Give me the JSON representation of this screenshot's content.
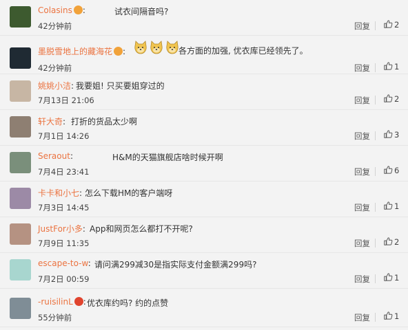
{
  "comments": [
    {
      "user": "Colasins",
      "text": "试衣间隔音吗?",
      "time": "42分钟前",
      "reply": "回复",
      "likes": "2",
      "badge": "#f1a23a",
      "avatar": "#3d5a2f"
    },
    {
      "user": "墨脱雪地上的藏海花",
      "text": "各方面的加强, 优衣库已经领先了。",
      "time": "42分钟前",
      "reply": "回复",
      "likes": "1",
      "badge": "#f1a23a",
      "avatar": "#1f2a33"
    },
    {
      "user": "姚姚小洁",
      "text": "我要姐! 只买要姐穿过的",
      "time": "7月13日 21:06",
      "reply": "回复",
      "likes": "2",
      "avatar": "#c7b6a4"
    },
    {
      "user": "轩大奇",
      "text": "打折的货品太少啊",
      "time": "7月1日 14:26",
      "reply": "回复",
      "likes": "3",
      "avatar": "#8e7f72"
    },
    {
      "user": "Seraout",
      "text": "H&M的天猫旗舰店啥时候开啊",
      "time": "7月4日 23:41",
      "reply": "回复",
      "likes": "6",
      "avatar": "#7a8f7b"
    },
    {
      "user": "卡卡和小七",
      "text": "怎么下载HM的客户端呀",
      "time": "7月3日 14:45",
      "reply": "回复",
      "likes": "1",
      "avatar": "#9c8aa6"
    },
    {
      "user": "JustFor小多",
      "text": "App和网页怎么都打不开呢?",
      "time": "7月9日 11:35",
      "reply": "回复",
      "likes": "2",
      "avatar": "#b59282"
    },
    {
      "user": "escape-to-w",
      "text": "请问满299减30是指实际支付金额满299吗?",
      "time": "7月2日 00:59",
      "reply": "回复",
      "likes": "1",
      "avatar": "#a8d6cf"
    },
    {
      "user": "-ruisilinL",
      "text": "优衣库约吗? 约的点赞",
      "time": "55分钟前",
      "reply": "回复",
      "likes": "1",
      "badge": "#e0442e",
      "avatar": "#7f8d96"
    }
  ],
  "colors": {
    "username": "#eb7340",
    "text": "#333333",
    "background": "#f3f3f3"
  },
  "icons": {
    "like": "thumbs-up-icon",
    "emoji": "doge-emoji-icon"
  }
}
